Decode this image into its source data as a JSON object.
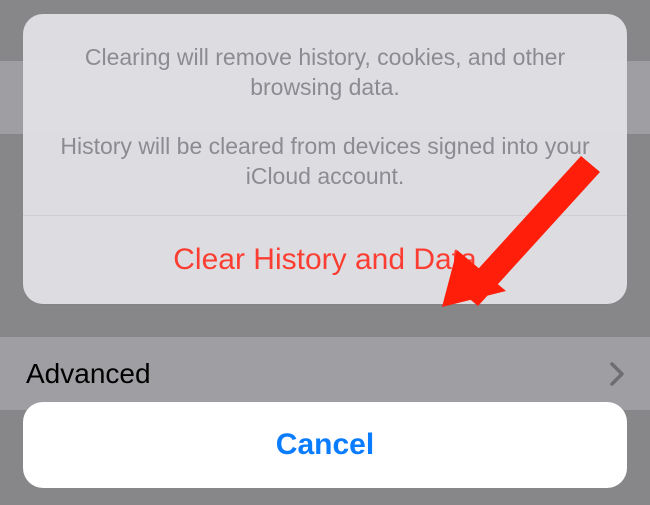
{
  "background": {
    "row1_label": "",
    "row2_label": "Advanced"
  },
  "sheet": {
    "message_line1": "Clearing will remove history, cookies, and other browsing data.",
    "message_line2": "History will be cleared from devices signed into your iCloud account.",
    "destructive_label": "Clear History and Data",
    "cancel_label": "Cancel"
  },
  "colors": {
    "destructive": "#fc3d32",
    "primary": "#0a7cff",
    "arrow": "#ff1e0a"
  }
}
